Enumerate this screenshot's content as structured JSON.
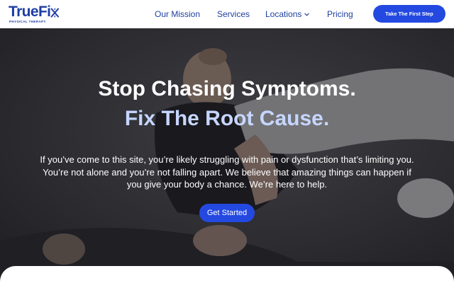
{
  "brand": {
    "name": "TrueFi",
    "tagline": "PHYSICAL THERAPY",
    "accent": "#1f3ea3",
    "logo_icon": "star-x-icon"
  },
  "nav": {
    "items": [
      {
        "label": "Our Mission"
      },
      {
        "label": "Services"
      },
      {
        "label": "Locations"
      },
      {
        "label": "Pricing"
      }
    ],
    "locations_icon": "chevron-down-icon",
    "cta_label": "Take The First Step"
  },
  "hero": {
    "title_line1": "Stop Chasing Symptoms.",
    "title_line2": "Fix The Root Cause.",
    "body": "If you’ve come to this site, you’re likely struggling with pain or dysfunction that’s limiting you. You’re not alone and you’re not falling apart. We believe that amazing things can happen if you give your body a chance. We’re here to help.",
    "cta_label": "Get Started",
    "title2_color": "#c6d6ff",
    "button_color": "#2449e0"
  }
}
